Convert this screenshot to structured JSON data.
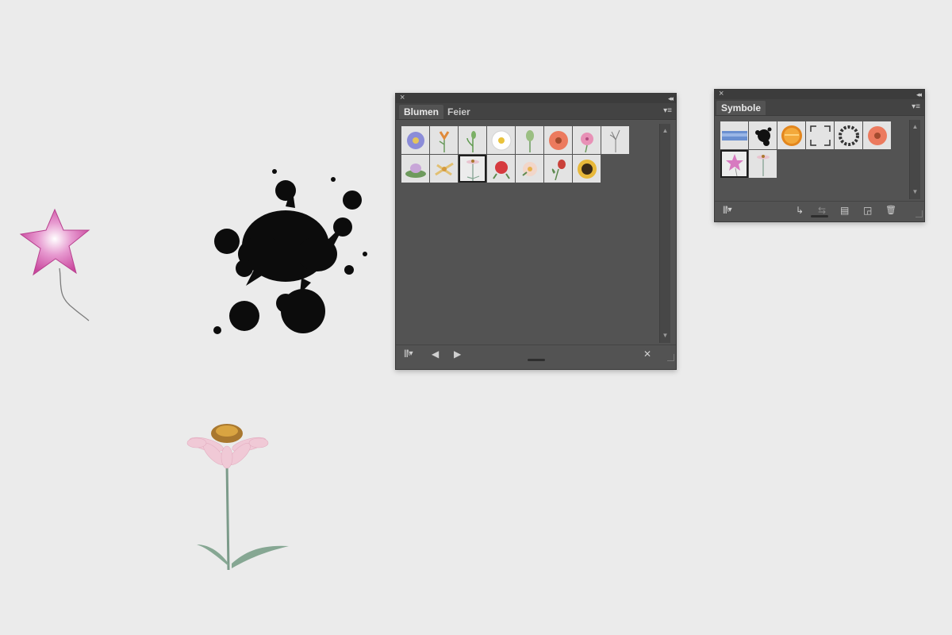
{
  "colors": {
    "canvas": "#ebebeb",
    "panel_bg": "#535353",
    "swatch_bg": "#e3e3e3"
  },
  "canvas_objects": [
    "pink-star-balloon",
    "ink-splatter",
    "echinacea-flower"
  ],
  "brush_library_panel": {
    "tabs": [
      {
        "label": "Blumen",
        "active": true
      },
      {
        "label": "Feier",
        "active": false
      }
    ],
    "items": [
      "aster",
      "lily",
      "tulip-sprout",
      "daisy",
      "tulip",
      "gerbera",
      "hibiscus",
      "iris",
      "water-lily",
      "lily-white",
      "echinacea",
      "rose",
      "magnolia",
      "tulip-red",
      "sunflower"
    ],
    "selected_index": 10,
    "icons": {
      "library_menu": "library-icon",
      "prev": "previous-icon",
      "next": "next-icon",
      "remove": "remove-brush-icon",
      "panel_menu": "panel-menu-icon"
    },
    "glyphs": {
      "close": "×",
      "collapse": "◂◂",
      "menu": "▾≡",
      "library": "|||\\▾",
      "prev": "◀",
      "next": "▶",
      "remove": "✕",
      "scroll_up": "▲",
      "scroll_down": "▼"
    }
  },
  "symbols_panel": {
    "tabs": [
      {
        "label": "Symbole",
        "active": true
      }
    ],
    "items": [
      "blue-banner",
      "ink-splatter",
      "orange-button",
      "frame-corners",
      "wreath",
      "gerbera",
      "pink-star-balloon",
      "echinacea"
    ],
    "selected_index": 6,
    "icons": [
      "library-icon",
      "place-symbol-icon",
      "break-link-icon",
      "symbol-options-icon",
      "new-symbol-icon",
      "trash-icon"
    ],
    "glyphs": {
      "close": "×",
      "collapse": "◂◂",
      "menu": "▾≡",
      "library": "|||\\▾",
      "place": "↳",
      "break": "⇆",
      "options": "▤",
      "new": "◲",
      "trash": "🗑",
      "scroll_up": "▲",
      "scroll_down": "▼"
    }
  }
}
